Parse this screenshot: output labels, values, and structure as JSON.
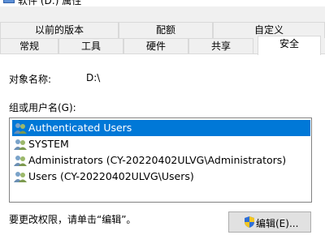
{
  "window": {
    "title": "软件 (D:) 属性"
  },
  "tabs_top": [
    "以前的版本",
    "配额",
    "自定义"
  ],
  "tabs_bottom": [
    "常规",
    "工具",
    "硬件",
    "共享",
    "安全"
  ],
  "object": {
    "label": "对象名称:",
    "value": "D:\\"
  },
  "group": {
    "label": "组或用户名(G):",
    "items": [
      "Authenticated Users",
      "SYSTEM",
      "Administrators (CY-20220402ULVG\\Administrators)",
      "Users (CY-20220402ULVG\\Users)"
    ],
    "selected_index": 0
  },
  "hint": "要更改权限，请单击“编辑”。",
  "edit_button": "编辑(E)...",
  "colors": {
    "selection": "#0078d7",
    "panel": "#ffffff",
    "background": "#f0f0f0"
  },
  "icons": {
    "user": "users-icon",
    "shield": "uac-shield-icon"
  }
}
